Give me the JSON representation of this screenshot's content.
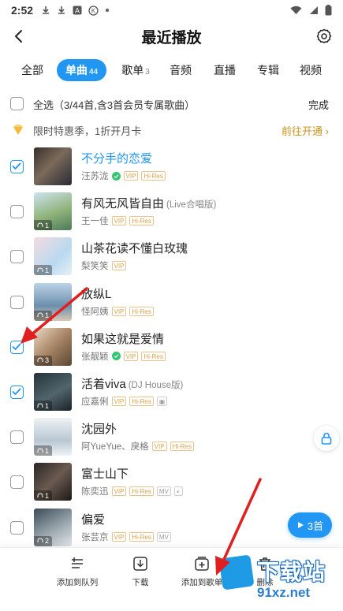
{
  "status_bar": {
    "time": "2:52",
    "icons": [
      "download-icon",
      "download-icon",
      "a-icon",
      "k-icon",
      "dot-icon"
    ],
    "right_icons": [
      "wifi-icon",
      "signal-icon",
      "battery-icon"
    ]
  },
  "header": {
    "title": "最近播放"
  },
  "tabs": [
    {
      "label": "全部",
      "count": ""
    },
    {
      "label": "单曲",
      "count": "44"
    },
    {
      "label": "歌单",
      "count": "3"
    },
    {
      "label": "音频",
      "count": ""
    },
    {
      "label": "直播",
      "count": ""
    },
    {
      "label": "专辑",
      "count": ""
    },
    {
      "label": "视频",
      "count": ""
    }
  ],
  "selection": {
    "select_all_label": "全选",
    "summary": "（3/44首,含3首会员专属歌曲）",
    "done_label": "完成"
  },
  "promo": {
    "text": "限时特惠季，1折开月卡",
    "link_label": "前往开通 ›"
  },
  "songs": [
    {
      "title": "不分手的恋爱",
      "version": "",
      "artist": "汪苏泷",
      "verified": true,
      "badges": [
        "VIP",
        "Hi-Res"
      ],
      "plays": "",
      "checked": true,
      "playing": true
    },
    {
      "title": "有风无风皆自由",
      "version": "(Live合唱版)",
      "artist": "王一佳",
      "verified": false,
      "badges": [
        "VIP",
        "Hi-Res"
      ],
      "plays": "1",
      "checked": false,
      "playing": false
    },
    {
      "title": "山茶花读不懂白玫瑰",
      "version": "",
      "artist": "梨笑笑",
      "verified": false,
      "badges": [
        "VIP"
      ],
      "plays": "1",
      "checked": false,
      "playing": false
    },
    {
      "title": "放纵L",
      "version": "",
      "artist": "怪阿姨",
      "verified": false,
      "badges": [
        "VIP",
        "Hi-Res"
      ],
      "plays": "1",
      "checked": false,
      "playing": false
    },
    {
      "title": "如果这就是爱情",
      "version": "",
      "artist": "张靓颖",
      "verified": true,
      "badges": [
        "VIP",
        "Hi-Res"
      ],
      "plays": "3",
      "checked": true,
      "playing": false
    },
    {
      "title": "活着viva",
      "version": "(DJ House版)",
      "artist": "应嘉俐",
      "verified": false,
      "badges": [
        "VIP",
        "Hi-Res",
        "▣"
      ],
      "plays": "1",
      "checked": true,
      "playing": false
    },
    {
      "title": "沈园外",
      "version": "",
      "artist": "阿YueYue、戾格",
      "verified": false,
      "badges": [
        "VIP",
        "Hi-Res"
      ],
      "plays": "1",
      "checked": false,
      "playing": false
    },
    {
      "title": "富士山下",
      "version": "",
      "artist": "陈奕迅",
      "verified": false,
      "badges": [
        "VIP",
        "Hi-Res",
        "MV",
        "◐"
      ],
      "plays": "1",
      "checked": false,
      "playing": false
    },
    {
      "title": "偏爱",
      "version": "",
      "artist": "张芸京",
      "verified": false,
      "badges": [
        "VIP",
        "Hi-Res",
        "MV"
      ],
      "plays": "2",
      "checked": false,
      "playing": false
    }
  ],
  "float_play": {
    "label": "3首"
  },
  "actions": [
    {
      "label": "添加到队列",
      "icon": "queue-icon"
    },
    {
      "label": "下载",
      "icon": "download-icon"
    },
    {
      "label": "添加到歌单",
      "icon": "add-playlist-icon"
    },
    {
      "label": "删除",
      "icon": "trash-icon"
    }
  ],
  "watermark": {
    "title": "下载站",
    "url": "91xz.net"
  },
  "colors": {
    "accent": "#2196f3",
    "vip_gold": "#d9a24a",
    "promo_link": "#c8941e",
    "annotation_red": "#e02020"
  }
}
